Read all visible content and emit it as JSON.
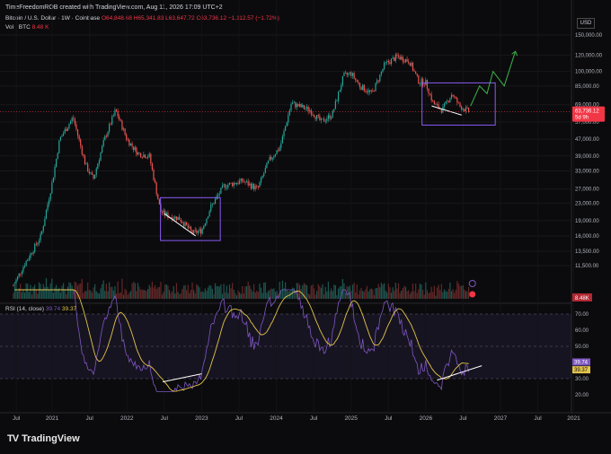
{
  "header": {
    "credit": "TimeFreedomROB created with TradingView.com, Aug 11, 2026 17:09 UTC+2",
    "symbol": "Bitcoin / U.S. Dollar · 1W · Coinbase",
    "ohlc": "O64,848.68 H65,341.83 L63,647.72 C63,736.12 −1,112.57 (−1.72%)",
    "vol_label": "Vol · BTC",
    "vol_value": "8.48 K",
    "currency": "USD"
  },
  "price_badge": {
    "price": "63,736.12",
    "countdown": "5d 9h",
    "color": "#f23645"
  },
  "vol_badge": "8.48K",
  "rsi": {
    "label": "RSI (14, close)",
    "value1": "39.74",
    "value2": "39.37",
    "color_rsi": "#7e57c2",
    "color_ma": "#e3c44b"
  },
  "brand": {
    "logo": "TV",
    "name": "TradingView"
  },
  "chart_data": [
    {
      "type": "candlestick",
      "scale": "log",
      "y_ticks": [
        "150,000.00",
        "120,000.00",
        "100,000.00",
        "85,000.00",
        "69,000.00",
        "57,000.00",
        "47,000.00",
        "39,000.00",
        "33,000.00",
        "27,000.00",
        "23,000.00",
        "19,000.00",
        "16,000.00",
        "13,500.00",
        "11,500.00"
      ],
      "x_ticks": [
        "Jul",
        "2021",
        "Jul",
        "2022",
        "Jul",
        "2023",
        "Jul",
        "2024",
        "Jul",
        "2025",
        "Jul",
        "2026",
        "Jul",
        "2027",
        "Jul",
        "2021"
      ],
      "series": [
        {
          "points": [
            [
              2020.48,
              9200
            ],
            [
              2020.62,
              11500
            ],
            [
              2020.85,
              16000
            ],
            [
              2021.0,
              29000
            ],
            [
              2021.1,
              47000
            ],
            [
              2021.28,
              60000
            ],
            [
              2021.45,
              35000
            ],
            [
              2021.55,
              30000
            ],
            [
              2021.7,
              47000
            ],
            [
              2021.85,
              65000
            ],
            [
              2022.0,
              47000
            ],
            [
              2022.15,
              40000
            ],
            [
              2022.3,
              39000
            ],
            [
              2022.45,
              21000
            ],
            [
              2022.55,
              20000
            ],
            [
              2022.7,
              19500
            ],
            [
              2022.88,
              16500
            ],
            [
              2023.0,
              17000
            ],
            [
              2023.12,
              22000
            ],
            [
              2023.3,
              28000
            ],
            [
              2023.55,
              29500
            ],
            [
              2023.75,
              27000
            ],
            [
              2023.9,
              37000
            ],
            [
              2024.05,
              43000
            ],
            [
              2024.2,
              70000
            ],
            [
              2024.45,
              65000
            ],
            [
              2024.6,
              57000
            ],
            [
              2024.75,
              62000
            ],
            [
              2024.9,
              95000
            ],
            [
              2025.0,
              98000
            ],
            [
              2025.12,
              85000
            ],
            [
              2025.28,
              78000
            ],
            [
              2025.45,
              108000
            ],
            [
              2025.62,
              118000
            ],
            [
              2025.78,
              112000
            ],
            [
              2025.9,
              90000
            ],
            [
              2026.0,
              88000
            ],
            [
              2026.1,
              70000
            ],
            [
              2026.22,
              65000
            ],
            [
              2026.35,
              78000
            ],
            [
              2026.45,
              68000
            ],
            [
              2026.58,
              63736
            ]
          ]
        },
        {
          "name": "projection",
          "color": "#3cb44b",
          "points": [
            [
              2026.6,
              68000
            ],
            [
              2026.72,
              85000
            ],
            [
              2026.82,
              78000
            ],
            [
              2026.9,
              100000
            ],
            [
              2027.05,
              85000
            ],
            [
              2027.2,
              125000
            ]
          ]
        }
      ],
      "rsi_ticks": [
        "70.00",
        "60.00",
        "50.00",
        "40.00",
        "30.00",
        "20.00"
      ],
      "rsi_levels": [
        70,
        50,
        30
      ]
    }
  ]
}
